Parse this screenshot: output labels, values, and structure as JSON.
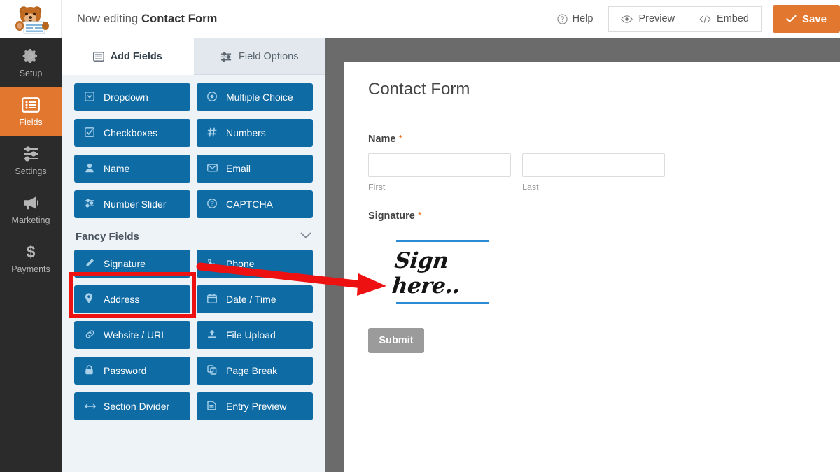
{
  "header": {
    "logo_alt": "wpforms-bear-logo",
    "editing_prefix": "Now editing ",
    "form_name": "Contact Form",
    "help_label": "Help",
    "preview_label": "Preview",
    "embed_label": "Embed",
    "save_label": "Save",
    "save_color": "#e27730"
  },
  "sidebar": {
    "active_color": "#e27730",
    "items": [
      {
        "label": "Setup",
        "icon": "gear-icon",
        "active": false
      },
      {
        "label": "Fields",
        "icon": "list-icon",
        "active": true
      },
      {
        "label": "Settings",
        "icon": "sliders-icon",
        "active": false
      },
      {
        "label": "Marketing",
        "icon": "megaphone-icon",
        "active": false
      },
      {
        "label": "Payments",
        "icon": "dollar-icon",
        "active": false
      }
    ]
  },
  "panel": {
    "tabs": [
      {
        "label": "Add Fields",
        "icon": "fields-icon",
        "active": true
      },
      {
        "label": "Field Options",
        "icon": "options-icon",
        "active": false
      }
    ],
    "button_color": "#0f6ba4",
    "standard_fields": [
      {
        "label": "Dropdown",
        "icon": "dropdown-icon"
      },
      {
        "label": "Multiple Choice",
        "icon": "radio-icon"
      },
      {
        "label": "Checkboxes",
        "icon": "checkbox-icon"
      },
      {
        "label": "Numbers",
        "icon": "hash-icon"
      },
      {
        "label": "Name",
        "icon": "user-icon"
      },
      {
        "label": "Email",
        "icon": "envelope-icon"
      },
      {
        "label": "Number Slider",
        "icon": "sliders-icon"
      },
      {
        "label": "CAPTCHA",
        "icon": "question-circle-icon"
      }
    ],
    "fancy_section": {
      "title": "Fancy Fields",
      "collapse_icon": "chevron-down-icon"
    },
    "fancy_fields": [
      {
        "label": "Signature",
        "icon": "pencil-icon",
        "highlighted": true
      },
      {
        "label": "Phone",
        "icon": "phone-icon"
      },
      {
        "label": "Address",
        "icon": "map-pin-icon"
      },
      {
        "label": "Date / Time",
        "icon": "calendar-icon"
      },
      {
        "label": "Website / URL",
        "icon": "link-icon"
      },
      {
        "label": "File Upload",
        "icon": "upload-icon"
      },
      {
        "label": "Password",
        "icon": "lock-icon"
      },
      {
        "label": "Page Break",
        "icon": "pages-icon"
      },
      {
        "label": "Section Divider",
        "icon": "arrows-horizontal-icon"
      },
      {
        "label": "Entry Preview",
        "icon": "document-icon"
      }
    ]
  },
  "preview": {
    "form_title": "Contact Form",
    "name_field": {
      "label": "Name",
      "required_mark": "*",
      "first_sublabel": "First",
      "last_sublabel": "Last",
      "first_value": "",
      "last_value": ""
    },
    "signature_field": {
      "label": "Signature",
      "required_mark": "*",
      "drawn_text": "Sign here..",
      "line_color": "#2b8bd4"
    },
    "submit_label": "Submit"
  },
  "annotations": {
    "highlight_color": "#ee1111",
    "highlight_target": "Signature",
    "arrow_points_to": "signature-preview-field"
  }
}
